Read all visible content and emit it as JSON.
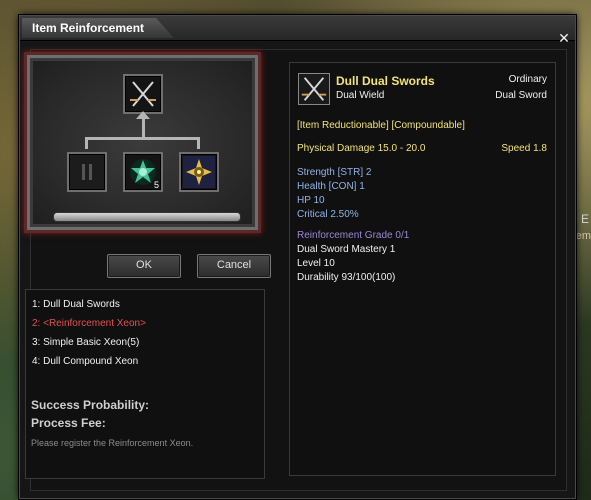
{
  "window": {
    "title": "Item Reinforcement",
    "close_icon": "close-icon"
  },
  "reinforce": {
    "result_icon": "crossed-swords-icon",
    "slots": [
      {
        "icon": "pause-slot-icon",
        "count": ""
      },
      {
        "icon": "green-xeon-icon",
        "count": "5"
      },
      {
        "icon": "gold-compound-xeon-icon",
        "count": ""
      }
    ],
    "progress": 1.0
  },
  "buttons": {
    "ok": "OK",
    "cancel": "Cancel"
  },
  "list": {
    "items": [
      "1: Dull Dual Swords",
      "2: <Reinforcement Xeon>",
      "3: Simple Basic Xeon(5)",
      "4: Dull Compound Xeon"
    ],
    "success_label": "Success Probability:",
    "fee_label": "Process Fee:",
    "hint": "Please register the Reinforcement Xeon."
  },
  "item": {
    "name": "Dull Dual Swords",
    "rarity": "Ordinary",
    "subtype": "Dual Wield",
    "weapon_type": "Dual Sword",
    "tags": "[Item Reductionable] [Compoundable]",
    "physical_damage": "Physical Damage 15.0 - 20.0",
    "speed": "Speed 1.8",
    "stats": [
      "Strength [STR] 2",
      "Health [CON] 1",
      "HP 10",
      "Critical 2.50%"
    ],
    "grade": "Reinforcement Grade 0/1",
    "requirements": [
      "Dual Sword Mastery 1",
      "Level 10",
      "Durability 93/100(100)"
    ]
  },
  "background": {
    "side_text": "Reinforcem",
    "side_letter": "E"
  },
  "colors": {
    "accent_red": "#e05252",
    "stat_blue": "#93b2e8",
    "grade_purple": "#9c86d6",
    "name_yellow": "#f2e27a"
  }
}
